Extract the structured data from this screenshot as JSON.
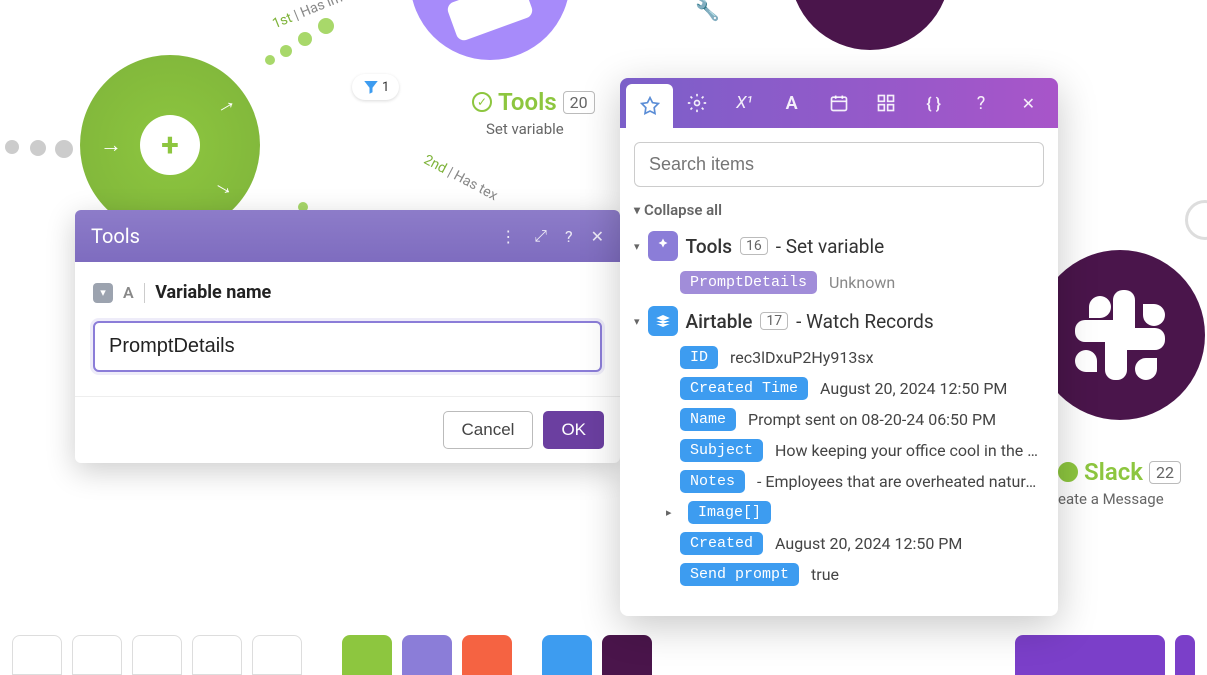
{
  "canvas": {
    "path1": {
      "order": "1st",
      "label": "Has imag"
    },
    "path2": {
      "order": "2nd",
      "label": "Has tex"
    },
    "filter_count": "1",
    "tools_node": {
      "label": "Tools",
      "badge": "20",
      "subtext": "Set variable"
    },
    "slack_node": {
      "label": "Slack",
      "badge": "22",
      "subtext": "eate a Message"
    }
  },
  "tools_modal": {
    "title": "Tools",
    "field_label": "Variable name",
    "field_value": "PromptDetails",
    "cancel": "Cancel",
    "ok": "OK"
  },
  "picker": {
    "search_placeholder": "Search items",
    "collapse_all": "Collapse all",
    "groups": [
      {
        "icon": "tools",
        "name": "Tools",
        "badge": "16",
        "desc": "- Set variable",
        "fields": [
          {
            "pill": "PromptDetails",
            "pill_color": "purple",
            "value": "Unknown",
            "value_color": "gray"
          }
        ]
      },
      {
        "icon": "airtable",
        "name": "Airtable",
        "badge": "17",
        "desc": "- Watch Records",
        "fields": [
          {
            "pill": "ID",
            "pill_color": "cyan",
            "value": "rec3lDxuP2Hy913sx"
          },
          {
            "pill": "Created Time",
            "pill_color": "cyan",
            "value": "August 20, 2024 12:50 PM"
          },
          {
            "pill": "Name",
            "pill_color": "cyan",
            "value": "Prompt sent on 08-20-24 06:50 PM"
          },
          {
            "pill": "Subject",
            "pill_color": "cyan",
            "value": "How keeping your office cool in the summ"
          },
          {
            "pill": "Notes",
            "pill_color": "cyan",
            "value": "- Employees that are overheated naturally w"
          },
          {
            "pill": "Image[]",
            "pill_color": "cyan",
            "value": "",
            "collapsible": true
          },
          {
            "pill": "Created",
            "pill_color": "cyan",
            "value": "August 20, 2024 12:50 PM"
          },
          {
            "pill": "Send prompt",
            "pill_color": "cyan",
            "value": "true"
          }
        ]
      }
    ]
  }
}
